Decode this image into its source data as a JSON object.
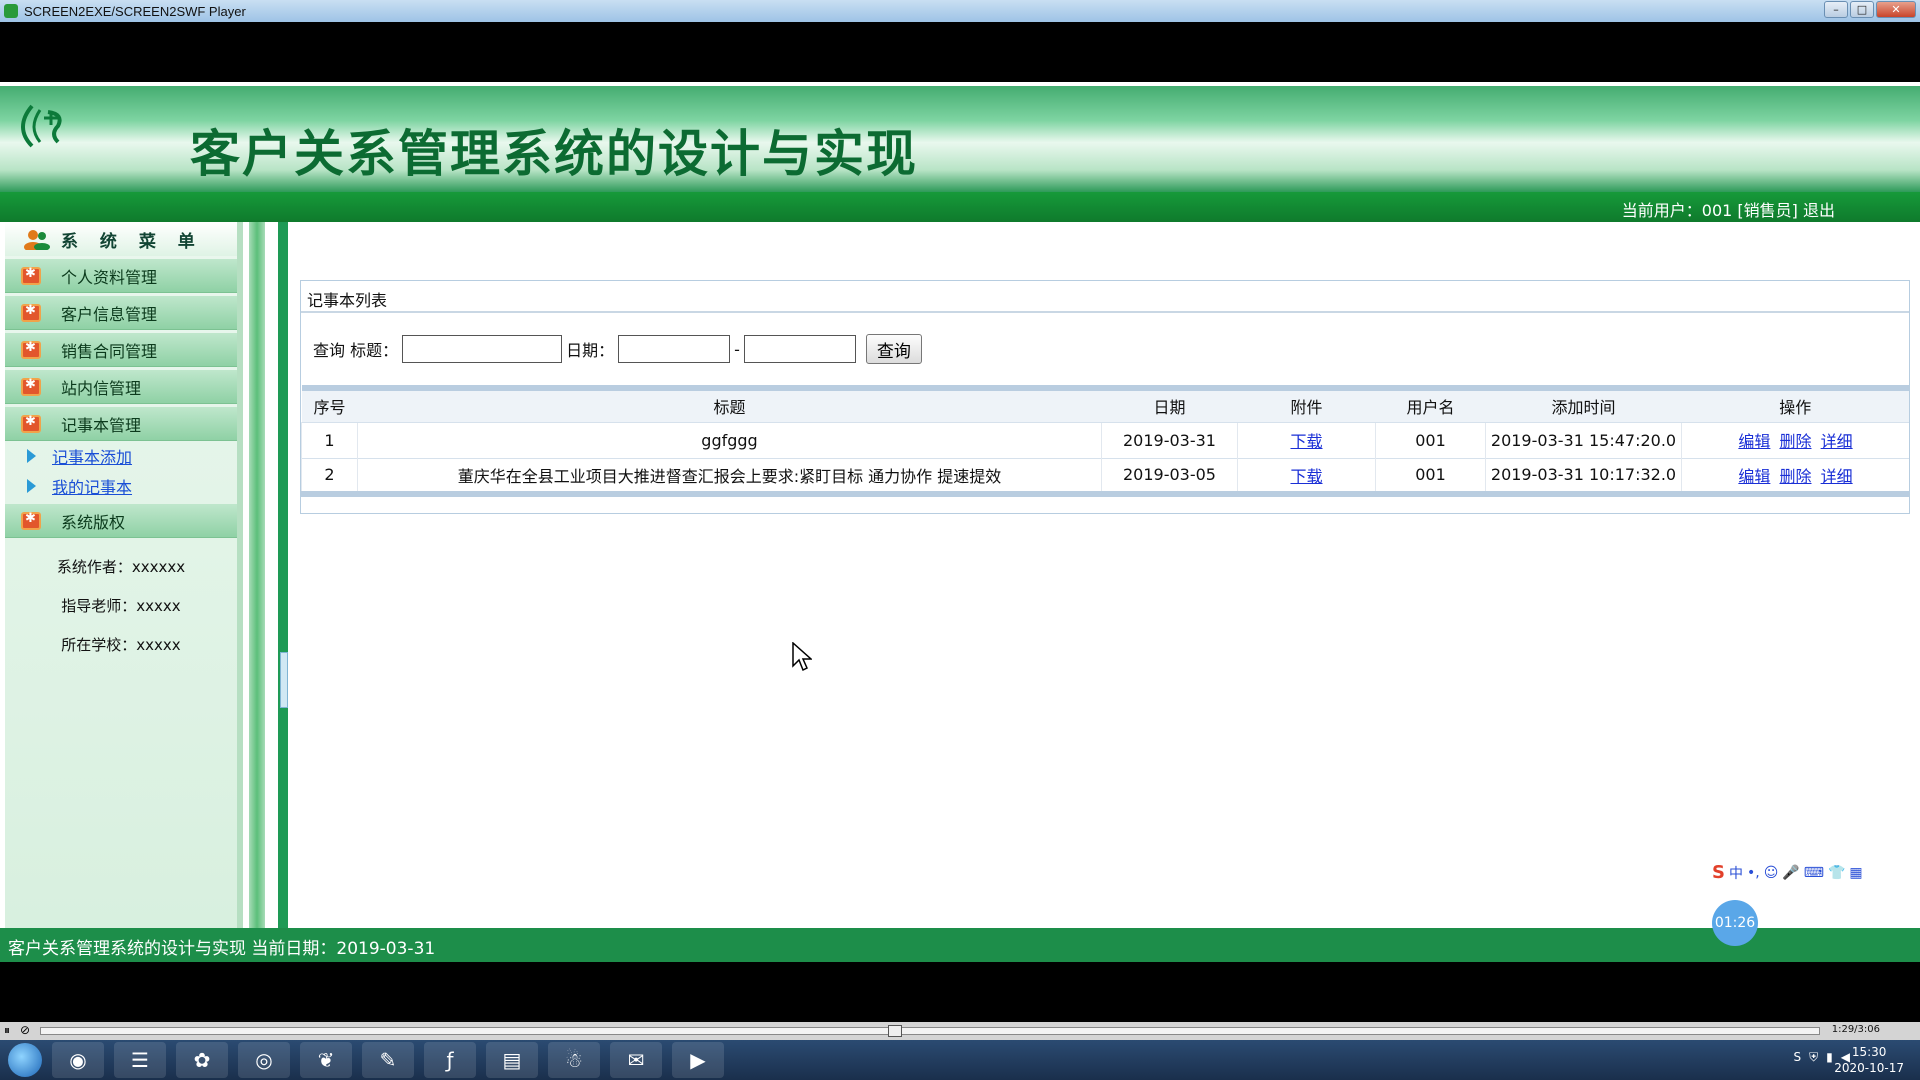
{
  "window": {
    "title": "SCREEN2EXE/SCREEN2SWF Player"
  },
  "header": {
    "site_title": "客户关系管理系统的设计与实现",
    "user_info": "当前用户：001 [销售员] 退出"
  },
  "sidebar": {
    "title": "系 统 菜 单",
    "items": [
      {
        "label": "个人资料管理"
      },
      {
        "label": "客户信息管理"
      },
      {
        "label": "销售合同管理"
      },
      {
        "label": "站内信管理"
      },
      {
        "label": "记事本管理"
      }
    ],
    "sub_items": [
      {
        "label": "记事本添加"
      },
      {
        "label": "我的记事本"
      }
    ],
    "copyright_label": "系统版权",
    "info": [
      {
        "text": "系统作者：xxxxxx"
      },
      {
        "text": "指导老师：xxxxx"
      },
      {
        "text": "所在学校：xxxxx"
      }
    ]
  },
  "panel": {
    "title": "记事本列表",
    "search": {
      "query_label": "查询 标题：",
      "title_value": "",
      "date_label": "日期：",
      "date_from": "",
      "dash": "-",
      "date_to": "",
      "button": "查询"
    },
    "table": {
      "headers": [
        "序号",
        "标题",
        "日期",
        "附件",
        "用户名",
        "添加时间",
        "操作"
      ],
      "rows": [
        {
          "no": "1",
          "title": "ggfggg",
          "date": "2019-03-31",
          "attachment": "下载",
          "user": "001",
          "added": "2019-03-31 15:47:20.0"
        },
        {
          "no": "2",
          "title": "董庆华在全县工业项目大推进督查汇报会上要求:紧盯目标 通力协作 提速提效",
          "date": "2019-03-05",
          "attachment": "下载",
          "user": "001",
          "added": "2019-03-31 10:17:32.0"
        }
      ],
      "actions": [
        "编辑",
        "删除",
        "详细"
      ]
    }
  },
  "footer": {
    "text": "客户关系管理系统的设计与实现 当前日期：2019-03-31"
  },
  "overlay": {
    "timer": "01:26",
    "ime_label": "中"
  },
  "player": {
    "time": "1:29/3:06"
  },
  "taskbar": {
    "time": "15:30",
    "date": "2020-10-17"
  },
  "colors": {
    "brand_green": "#1d8e4a",
    "title_green": "#0c6b32",
    "link_blue": "#1a2fd6"
  }
}
